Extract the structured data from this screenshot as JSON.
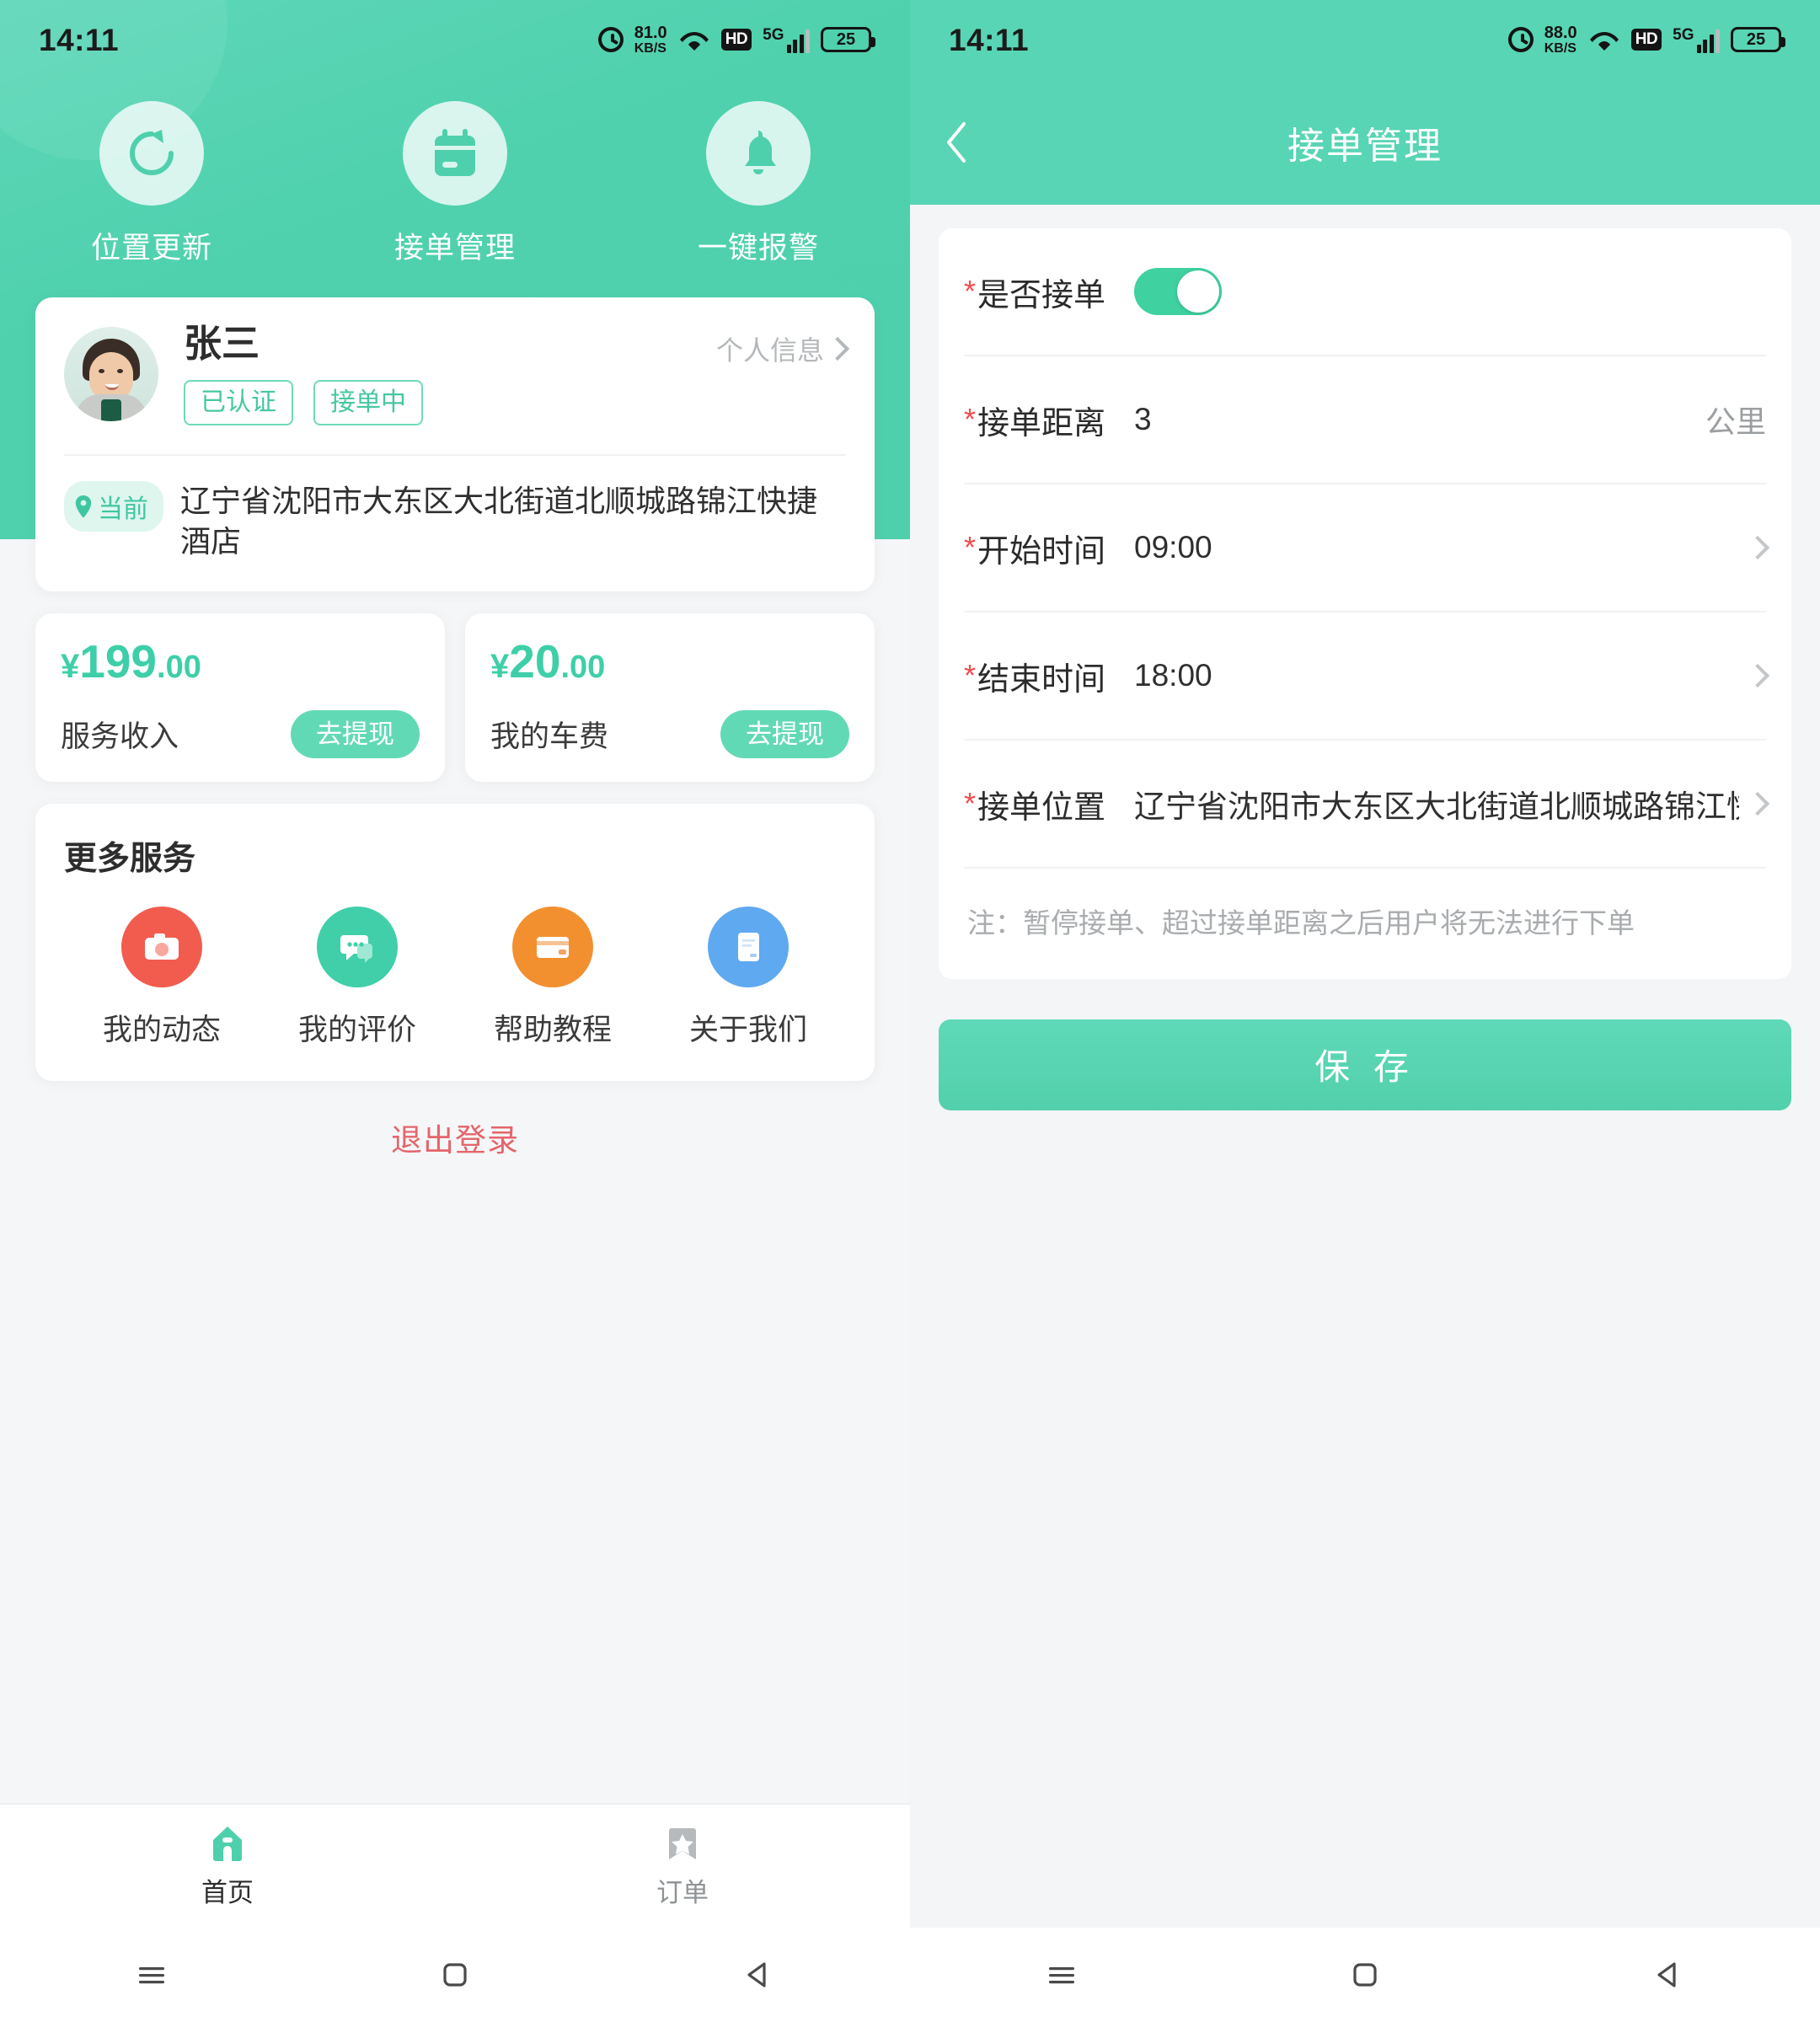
{
  "theme": {
    "primary": "#4ed0ac",
    "primary_light": "#62d9b5",
    "accent_green": "#3ecfa8",
    "danger_red": "#e4656b",
    "star_red": "#f14c4c",
    "text_dark": "#2d2d2d",
    "text_muted": "#9b9ea0"
  },
  "left": {
    "status_bar": {
      "time": "14:11",
      "net_speed_value": "81.0",
      "net_speed_unit": "KB/S",
      "hd_label": "HD",
      "network": "5G",
      "battery": "25",
      "icons": [
        "alarm-icon",
        "wifi-icon",
        "hd-icon",
        "signal-icon",
        "battery-icon"
      ]
    },
    "quick_actions": [
      {
        "label": "位置更新",
        "icon": "refresh-icon"
      },
      {
        "label": "接单管理",
        "icon": "calendar-icon"
      },
      {
        "label": "一键报警",
        "icon": "bell-icon"
      }
    ],
    "profile": {
      "name": "张三",
      "info_link": "个人信息",
      "badges": [
        "已认证",
        "接单中"
      ],
      "address_tag": "当前",
      "address": "辽宁省沈阳市大东区大北街道北顺城路锦江快捷酒店"
    },
    "stats": [
      {
        "currency": "¥",
        "amount_int": "199",
        "amount_dec": ".00",
        "label": "服务收入",
        "action": "去提现"
      },
      {
        "currency": "¥",
        "amount_int": "20",
        "amount_dec": ".00",
        "label": "我的车费",
        "action": "去提现"
      }
    ],
    "more_services": {
      "title": "更多服务",
      "items": [
        {
          "label": "我的动态",
          "icon": "camera-icon",
          "color": "#f25c4f"
        },
        {
          "label": "我的评价",
          "icon": "chat-icon",
          "color": "#40cfa8"
        },
        {
          "label": "帮助教程",
          "icon": "card-icon",
          "color": "#f2902f"
        },
        {
          "label": "关于我们",
          "icon": "document-icon",
          "color": "#5fa9f0"
        }
      ]
    },
    "logout_label": "退出登录",
    "tabbar": [
      {
        "label": "首页",
        "icon": "home-icon",
        "active": true
      },
      {
        "label": "订单",
        "icon": "bookmark-star-icon",
        "active": false
      }
    ],
    "nav_buttons": [
      "menu-icon",
      "home-square-icon",
      "back-triangle-icon"
    ]
  },
  "right": {
    "status_bar": {
      "time": "14:11",
      "net_speed_value": "88.0",
      "net_speed_unit": "KB/S",
      "hd_label": "HD",
      "network": "5G",
      "battery": "25"
    },
    "header": {
      "title": "接单管理",
      "back_icon": "chevron-left-icon"
    },
    "form": {
      "rows": [
        {
          "required": "*",
          "label": "是否接单",
          "type": "toggle",
          "value": "on"
        },
        {
          "required": "*",
          "label": "接单距离",
          "type": "input",
          "value": "3",
          "unit": "公里"
        },
        {
          "required": "*",
          "label": "开始时间",
          "type": "picker",
          "value": "09:00"
        },
        {
          "required": "*",
          "label": "结束时间",
          "type": "picker",
          "value": "18:00"
        },
        {
          "required": "*",
          "label": "接单位置",
          "type": "picker",
          "value": "辽宁省沈阳市大东区大北街道北顺城路锦江快捷酒店"
        }
      ],
      "note": "注：暂停接单、超过接单距离之后用户将无法进行下单"
    },
    "save_label": "保 存",
    "nav_buttons": [
      "menu-icon",
      "home-square-icon",
      "back-triangle-icon"
    ]
  }
}
